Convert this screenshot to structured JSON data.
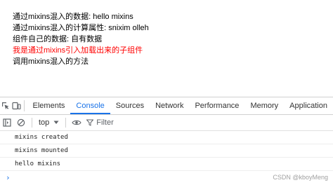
{
  "page_content": {
    "lines": [
      "通过mixins混入的数据: hello mixins",
      "通过mixins混入的计算属性: snixim olleh",
      "组件自己的数据: 自有数据",
      "我是通过mixins引入加载出来的子组件",
      "调用mixins混入的方法"
    ],
    "highlight_color": "#ff0000"
  },
  "devtools": {
    "tabs": [
      "Elements",
      "Console",
      "Sources",
      "Network",
      "Performance",
      "Memory",
      "Application"
    ],
    "active_tab": "Console",
    "accent_color": "#1a73e8",
    "icons": {
      "inspect": "inspect-element-icon",
      "device": "device-toggle-icon",
      "sidebar": "sidebar-toggle-icon",
      "clear": "clear-console-icon",
      "dropdown": "chevron-down-icon",
      "eye": "eye-icon",
      "filter": "filter-icon",
      "prompt": "prompt-chevron-icon"
    },
    "toolbar": {
      "context": "top",
      "filter_label": "Filter"
    },
    "console_messages": [
      "mixins created",
      "mixins mounted",
      "hello mixins"
    ],
    "prompt_symbol": "›"
  },
  "watermark": "CSDN @kboyMeng"
}
